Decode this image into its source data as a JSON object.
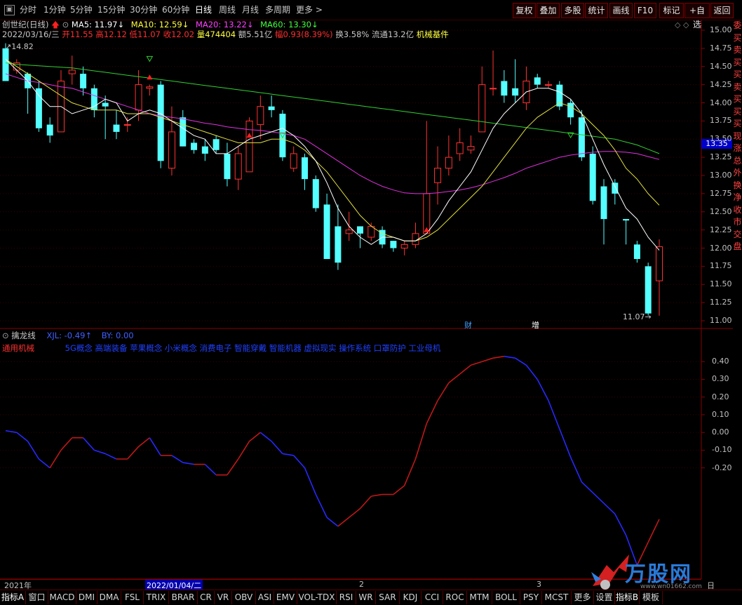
{
  "toolbar": {
    "items": [
      "分时",
      "1分钟",
      "5分钟",
      "15分钟",
      "30分钟",
      "60分钟",
      "日线",
      "周线",
      "月线",
      "多周期",
      "更多 >"
    ],
    "buttons": [
      "复权",
      "叠加",
      "多股",
      "统计",
      "画线",
      "F10",
      "标记",
      "+自选",
      "返回"
    ]
  },
  "stock": {
    "name": "创世纪(日线)",
    "date": "2022/03/16/三",
    "open_label": "开",
    "open": "11.55",
    "high_label": "高",
    "high": "12.12",
    "low_label": "低",
    "low": "11.07",
    "close_label": "收",
    "close": "12.02",
    "vol_label": "量",
    "vol": "474404",
    "amt_label": "额",
    "amt": "5.51亿",
    "chg_label": "幅",
    "chg": "0.93(8.39%)",
    "turnover": "换3.58%",
    "float": "流通13.2亿",
    "sector": "机械基件",
    "ma5": "MA5: 11.97↓",
    "ma10": "MA10: 12.59↓",
    "ma20": "MA20: 13.22↓",
    "ma60": "MA60: 13.30↓",
    "high_mark": "14.82",
    "low_mark": "11.07",
    "current_price": "13.35",
    "event_cai": "财",
    "event_zeng": "增"
  },
  "price_axis": [
    "15.00",
    "14.75",
    "14.50",
    "14.25",
    "14.00",
    "13.75",
    "13.50",
    "13.25",
    "13.00",
    "12.75",
    "12.50",
    "12.25",
    "12.00",
    "11.75",
    "11.50",
    "11.25",
    "11.00"
  ],
  "indicator": {
    "name": "擒龙线",
    "xjl": "XJL: -0.49↑",
    "by": "BY: 0.00",
    "industry": "通用机械",
    "concepts": "5G概念 高端装备 苹果概念 小米概念 消费电子 智能穿戴 智能机器 虚拟现实 操作系统 口罩防护 工业母机",
    "axis": [
      "0.40",
      "0.30",
      "0.20",
      "0.10",
      "0.00",
      "-0.10",
      "-0.20"
    ]
  },
  "right_sidebar_text": [
    "委",
    "买",
    "卖",
    "买",
    "买",
    "卖",
    "买",
    "买",
    "买",
    "现",
    "涨",
    "总",
    "外",
    "换",
    "净",
    "收",
    "市",
    "交",
    "盘"
  ],
  "date_axis": {
    "left": "2021年",
    "highlight": "2022/01/04/二",
    "m2": "2",
    "m3": "3",
    "right": "日线"
  },
  "tabs": [
    "指标A",
    "窗口",
    "MACD",
    "DMI",
    "DMA",
    "FSL",
    "TRIX",
    "BRAR",
    "CR",
    "VR",
    "OBV",
    "ASI",
    "EMV",
    "VOL-TDX",
    "RSI",
    "WR",
    "SAR",
    "KDJ",
    "CCI",
    "ROC",
    "MTM",
    "BOLL",
    "PSY",
    "MCST",
    "更多",
    "设置",
    "指标B",
    "模板"
  ],
  "watermark": {
    "brand": "万股网",
    "url": "www.wn01662.com"
  },
  "chart_data": {
    "type": "candlestick",
    "ylim": [
      11.0,
      15.0
    ],
    "candles": [
      [
        14.75,
        14.3,
        14.82,
        14.3
      ],
      [
        14.45,
        14.55,
        14.6,
        14.4
      ],
      [
        14.4,
        14.2,
        14.42,
        13.85
      ],
      [
        14.2,
        13.65,
        14.3,
        13.6
      ],
      [
        13.7,
        13.55,
        13.8,
        13.45
      ],
      [
        13.6,
        14.3,
        14.45,
        13.6
      ],
      [
        14.4,
        14.45,
        14.65,
        14.25
      ],
      [
        14.4,
        14.2,
        14.5,
        14.1
      ],
      [
        14.2,
        13.9,
        14.25,
        13.8
      ],
      [
        14.0,
        13.95,
        14.1,
        13.5
      ],
      [
        13.7,
        13.6,
        13.9,
        13.5
      ],
      [
        13.7,
        13.7,
        13.8,
        13.6
      ],
      [
        13.9,
        14.25,
        14.45,
        13.75
      ],
      [
        14.2,
        14.22,
        14.25,
        14.1
      ],
      [
        14.25,
        13.2,
        14.3,
        13.1
      ],
      [
        13.1,
        13.6,
        13.95,
        13.0
      ],
      [
        13.8,
        13.4,
        13.9,
        13.4
      ],
      [
        13.45,
        13.35,
        13.5,
        13.3
      ],
      [
        13.4,
        13.3,
        13.5,
        13.2
      ],
      [
        13.5,
        13.35,
        13.55,
        13.3
      ],
      [
        13.3,
        12.95,
        13.45,
        12.85
      ],
      [
        12.95,
        13.3,
        13.4,
        12.8
      ],
      [
        13.05,
        13.75,
        13.8,
        13.05
      ],
      [
        13.7,
        13.95,
        14.1,
        13.5
      ],
      [
        13.95,
        13.9,
        14.1,
        13.8
      ],
      [
        13.85,
        13.25,
        13.9,
        13.2
      ],
      [
        13.1,
        13.3,
        13.4,
        13.05
      ],
      [
        13.25,
        12.95,
        13.3,
        12.8
      ],
      [
        12.95,
        12.55,
        13.0,
        12.5
      ],
      [
        12.6,
        11.85,
        12.75,
        11.85
      ],
      [
        12.3,
        11.8,
        12.6,
        11.7
      ],
      [
        12.2,
        12.25,
        12.5,
        12.1
      ],
      [
        12.3,
        12.2,
        12.3,
        12.0
      ],
      [
        12.15,
        12.3,
        12.35,
        12.1
      ],
      [
        12.25,
        12.05,
        12.3,
        12.0
      ],
      [
        12.1,
        12.0,
        12.1,
        11.95
      ],
      [
        12.0,
        12.05,
        12.1,
        11.9
      ],
      [
        12.05,
        12.2,
        12.35,
        12.0
      ],
      [
        12.2,
        12.75,
        13.75,
        12.2
      ],
      [
        12.9,
        13.1,
        13.4,
        12.6
      ],
      [
        13.1,
        13.25,
        13.55,
        13.0
      ],
      [
        13.3,
        13.45,
        13.65,
        13.2
      ],
      [
        13.35,
        13.4,
        13.55,
        13.3
      ],
      [
        13.6,
        14.25,
        14.5,
        13.6
      ],
      [
        14.2,
        14.2,
        14.72,
        14.1
      ],
      [
        14.3,
        14.1,
        14.45,
        14.0
      ],
      [
        14.2,
        14.1,
        14.6,
        14.0
      ],
      [
        14.0,
        14.3,
        14.5,
        13.9
      ],
      [
        14.35,
        14.25,
        14.4,
        14.2
      ],
      [
        14.25,
        14.25,
        14.3,
        14.2
      ],
      [
        14.25,
        13.95,
        14.3,
        13.9
      ],
      [
        14.0,
        13.8,
        14.05,
        13.7
      ],
      [
        13.8,
        13.25,
        13.9,
        13.2
      ],
      [
        13.3,
        12.65,
        13.4,
        12.6
      ],
      [
        12.85,
        12.4,
        12.95,
        12.05
      ],
      [
        12.9,
        12.75,
        12.95,
        12.6
      ],
      [
        12.4,
        12.38,
        12.4,
        12.05
      ],
      [
        12.05,
        11.85,
        12.1,
        11.8
      ],
      [
        11.75,
        11.1,
        11.8,
        11.07
      ],
      [
        11.55,
        12.02,
        12.12,
        11.07
      ]
    ],
    "ma5": [
      14.6,
      14.45,
      14.3,
      14.1,
      13.95,
      13.95,
      13.85,
      13.9,
      13.95,
      14.05,
      14.0,
      13.75,
      13.85,
      13.9,
      13.85,
      13.75,
      13.65,
      13.55,
      13.5,
      13.3,
      13.3,
      13.4,
      13.5,
      13.55,
      13.6,
      13.65,
      13.55,
      13.4,
      13.2,
      12.9,
      12.55,
      12.3,
      12.15,
      12.05,
      12.15,
      12.15,
      12.1,
      12.1,
      12.2,
      12.4,
      12.65,
      12.85,
      13.05,
      13.35,
      13.65,
      13.85,
      14.0,
      14.15,
      14.2,
      14.2,
      14.15,
      14.05,
      13.85,
      13.5,
      13.15,
      12.85,
      12.55,
      12.4,
      12.15,
      11.97
    ],
    "ma10": [
      14.6,
      14.5,
      14.4,
      14.3,
      14.2,
      14.1,
      14.0,
      13.95,
      13.9,
      13.9,
      13.9,
      13.85,
      13.85,
      13.85,
      13.8,
      13.75,
      13.7,
      13.65,
      13.6,
      13.55,
      13.5,
      13.45,
      13.45,
      13.45,
      13.5,
      13.5,
      13.45,
      13.35,
      13.2,
      13.05,
      12.85,
      12.65,
      12.45,
      12.3,
      12.2,
      12.15,
      12.1,
      12.1,
      12.15,
      12.25,
      12.4,
      12.55,
      12.7,
      12.85,
      13.05,
      13.25,
      13.45,
      13.65,
      13.8,
      13.9,
      14.0,
      13.95,
      13.85,
      13.7,
      13.55,
      13.35,
      13.1,
      12.95,
      12.75,
      12.59
    ],
    "ma20": [
      14.4,
      14.35,
      14.3,
      14.28,
      14.25,
      14.22,
      14.2,
      14.15,
      14.1,
      14.05,
      14.0,
      13.95,
      13.9,
      13.85,
      13.82,
      13.8,
      13.78,
      13.75,
      13.72,
      13.7,
      13.67,
      13.65,
      13.63,
      13.62,
      13.6,
      13.58,
      13.55,
      13.5,
      13.4,
      13.3,
      13.2,
      13.1,
      13.0,
      12.92,
      12.85,
      12.8,
      12.76,
      12.75,
      12.75,
      12.76,
      12.78,
      12.8,
      12.83,
      12.87,
      12.92,
      12.97,
      13.03,
      13.1,
      13.15,
      13.2,
      13.25,
      13.28,
      13.3,
      13.32,
      13.33,
      13.33,
      13.32,
      13.3,
      13.26,
      13.22
    ],
    "ma60": [
      14.55,
      14.53,
      14.52,
      14.51,
      14.5,
      14.49,
      14.48,
      14.46,
      14.44,
      14.42,
      14.4,
      14.38,
      14.36,
      14.34,
      14.32,
      14.3,
      14.28,
      14.26,
      14.24,
      14.22,
      14.2,
      14.18,
      14.16,
      14.14,
      14.12,
      14.1,
      14.08,
      14.06,
      14.04,
      14.02,
      14.0,
      13.98,
      13.96,
      13.94,
      13.92,
      13.9,
      13.88,
      13.86,
      13.84,
      13.82,
      13.8,
      13.78,
      13.76,
      13.74,
      13.72,
      13.7,
      13.68,
      13.66,
      13.64,
      13.62,
      13.6,
      13.58,
      13.56,
      13.54,
      13.52,
      13.5,
      13.46,
      13.42,
      13.36,
      13.3
    ],
    "xjl": [
      0.01,
      0.0,
      -0.05,
      -0.15,
      -0.2,
      -0.1,
      -0.03,
      -0.03,
      -0.1,
      -0.12,
      -0.15,
      -0.15,
      -0.08,
      -0.03,
      -0.13,
      -0.13,
      -0.17,
      -0.18,
      -0.18,
      -0.24,
      -0.24,
      -0.15,
      -0.05,
      0.0,
      -0.05,
      -0.12,
      -0.13,
      -0.2,
      -0.35,
      -0.48,
      -0.53,
      -0.48,
      -0.43,
      -0.36,
      -0.35,
      -0.35,
      -0.3,
      -0.15,
      0.05,
      0.18,
      0.28,
      0.33,
      0.38,
      0.4,
      0.42,
      0.43,
      0.42,
      0.38,
      0.3,
      0.18,
      0.02,
      -0.14,
      -0.28,
      -0.34,
      -0.4,
      -0.46,
      -0.58,
      -0.75,
      -0.62,
      -0.49
    ],
    "xjl_ylim": [
      -0.8,
      0.5
    ]
  }
}
